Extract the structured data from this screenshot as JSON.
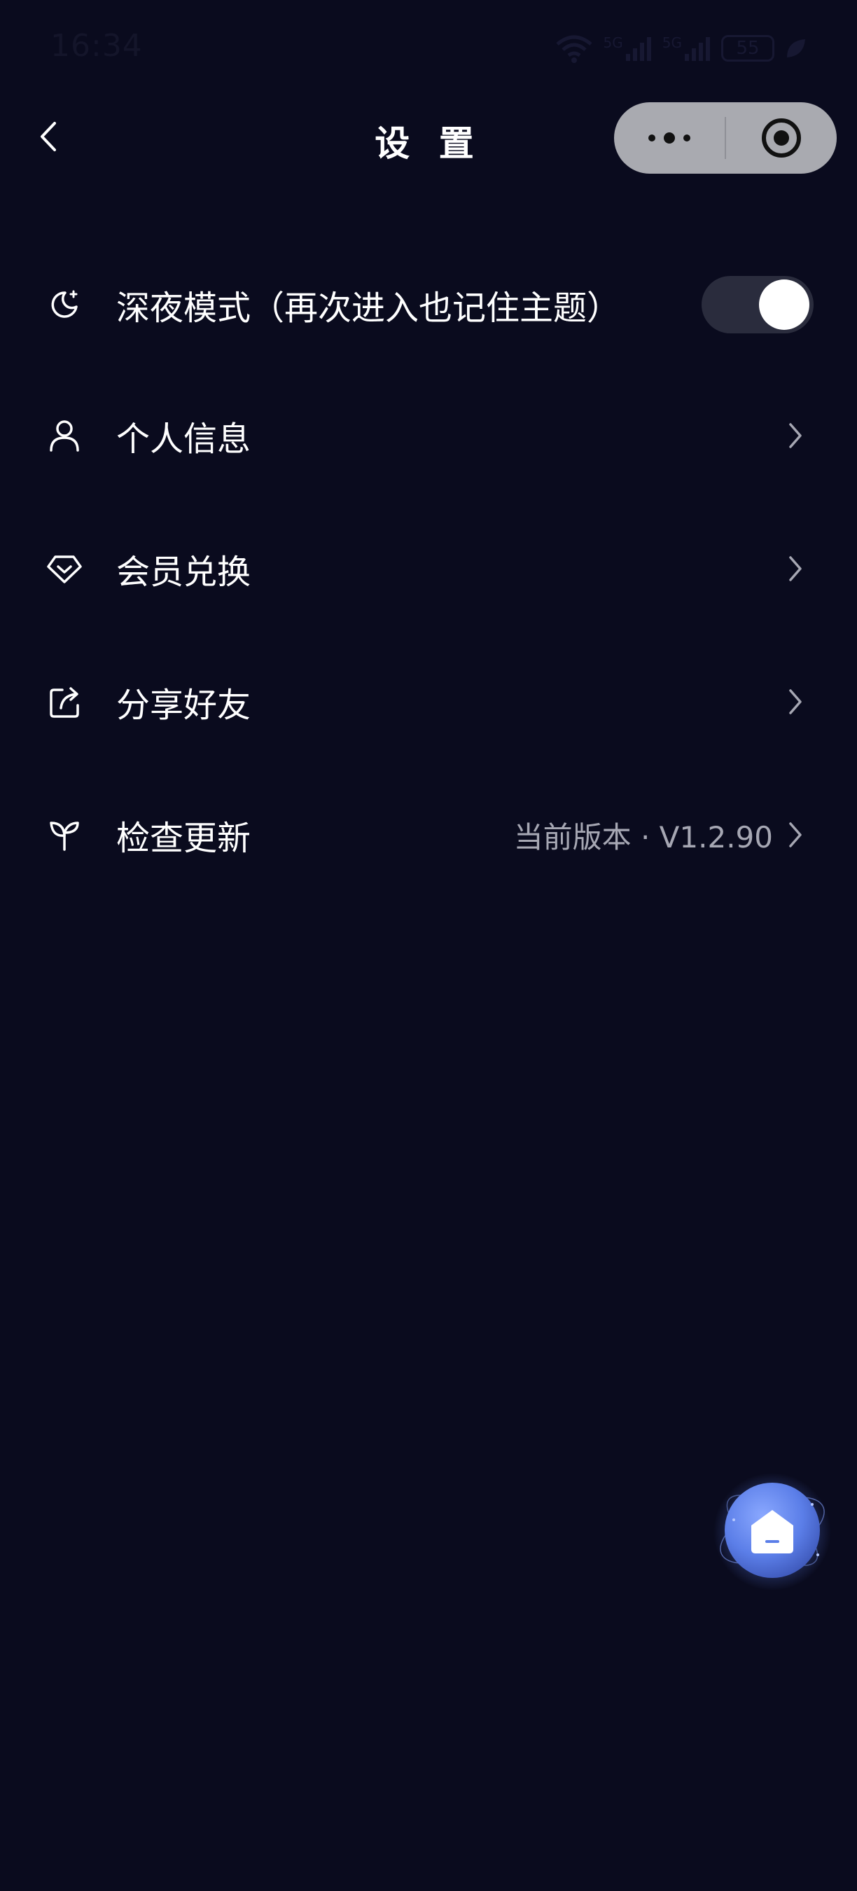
{
  "status_bar": {
    "time": "16:34",
    "network_1": "5G",
    "network_2": "5G",
    "battery": "55"
  },
  "nav": {
    "title": "设 置"
  },
  "settings": {
    "dark_mode": {
      "label": "深夜模式（再次进入也记住主题）",
      "enabled": true
    },
    "items": [
      {
        "label": "个人信息",
        "icon": "person-icon"
      },
      {
        "label": "会员兑换",
        "icon": "diamond-icon"
      },
      {
        "label": "分享好友",
        "icon": "share-icon"
      },
      {
        "label": "检查更新",
        "icon": "sprout-icon",
        "value": "当前版本 · V1.2.90"
      }
    ]
  },
  "colors": {
    "background": "#0a0b1e",
    "capsule": "#a9aab0",
    "toggle_track": "#2a2c3d",
    "secondary_text": "#a6a7b3",
    "float_button": "#5b7ee8"
  }
}
